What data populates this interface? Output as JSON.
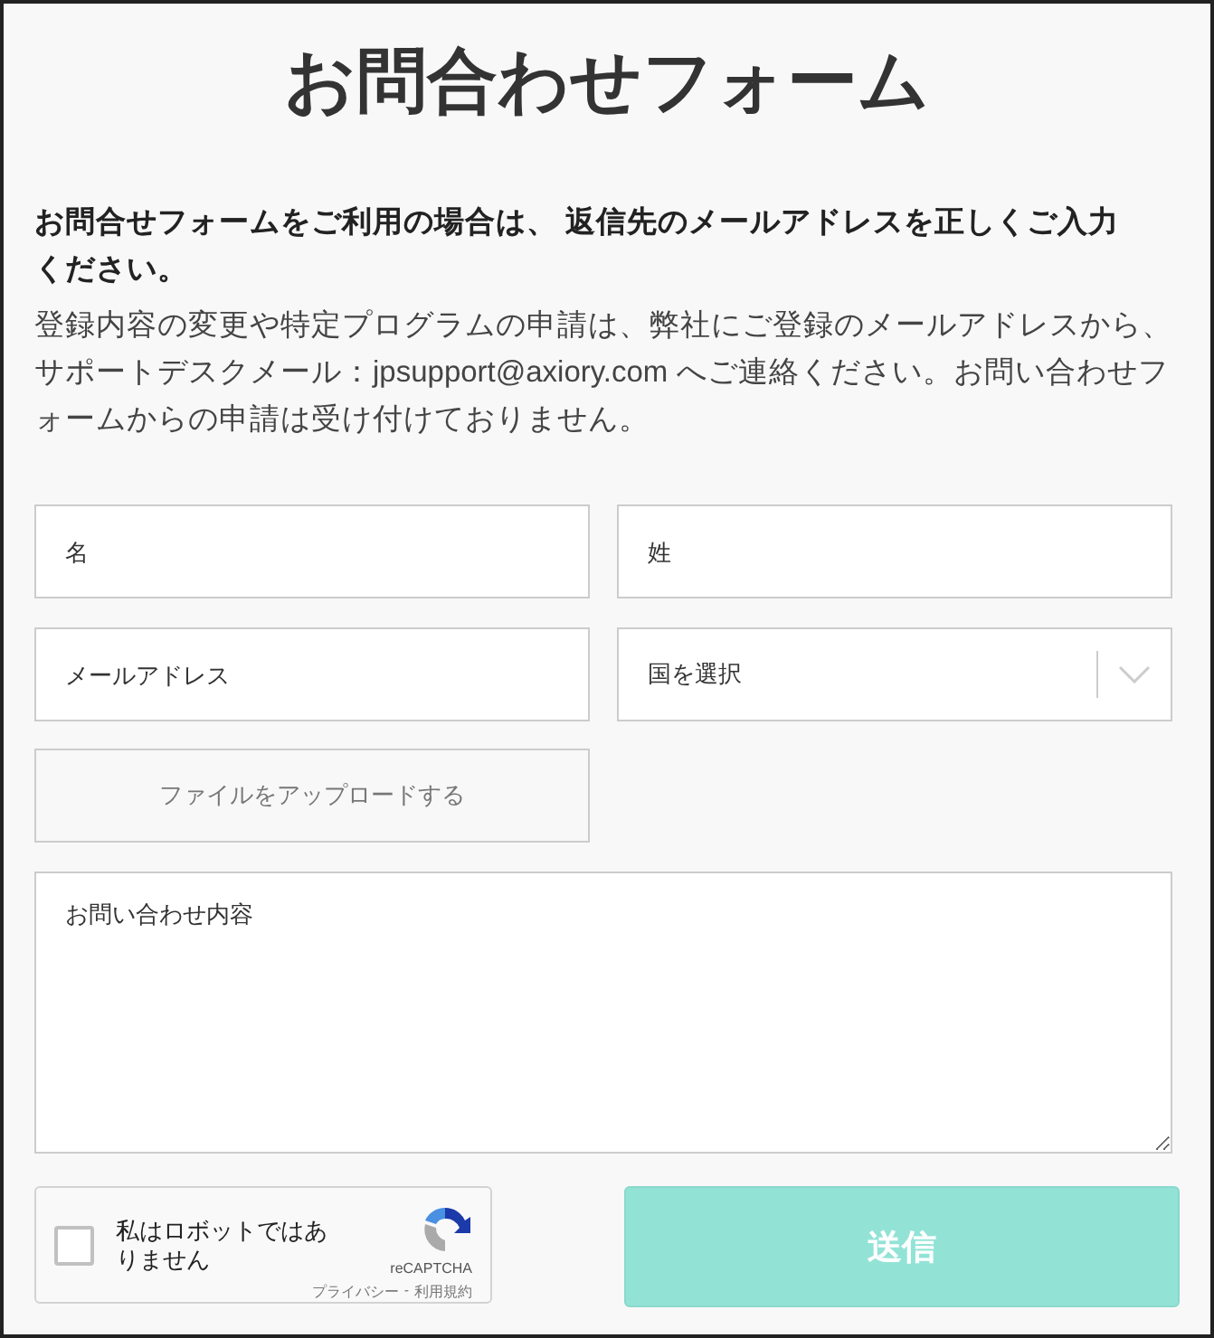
{
  "title": "お問合わせフォーム",
  "notice": "お問合せフォームをご利用の場合は、 返信先のメールアドレスを正しくご入力ください。",
  "description": "登録内容の変更や特定プログラムの申請は、弊社にご登録のメールアドレスから、サポートデスクメール：jpsupport@axiory.com へご連絡ください。お問い合わせフォームからの申請は受け付けておりません。",
  "fields": [
    {
      "kind": "text",
      "placeholder": "名"
    },
    {
      "kind": "text",
      "placeholder": "姓"
    },
    {
      "kind": "text",
      "placeholder": "メールアドレス"
    },
    {
      "kind": "select",
      "placeholder": "国を選択"
    },
    {
      "kind": "upload",
      "label": "ファイルをアップロードする"
    }
  ],
  "message": {
    "placeholder": "お問い合わせ内容"
  },
  "captcha": {
    "label": "私はロボットではありません",
    "checked": false,
    "brand": "reCAPTCHA",
    "privacy": "プライバシー",
    "separator": "-",
    "terms": "利用規約"
  },
  "submit": {
    "label": "送信",
    "disabled": true
  }
}
